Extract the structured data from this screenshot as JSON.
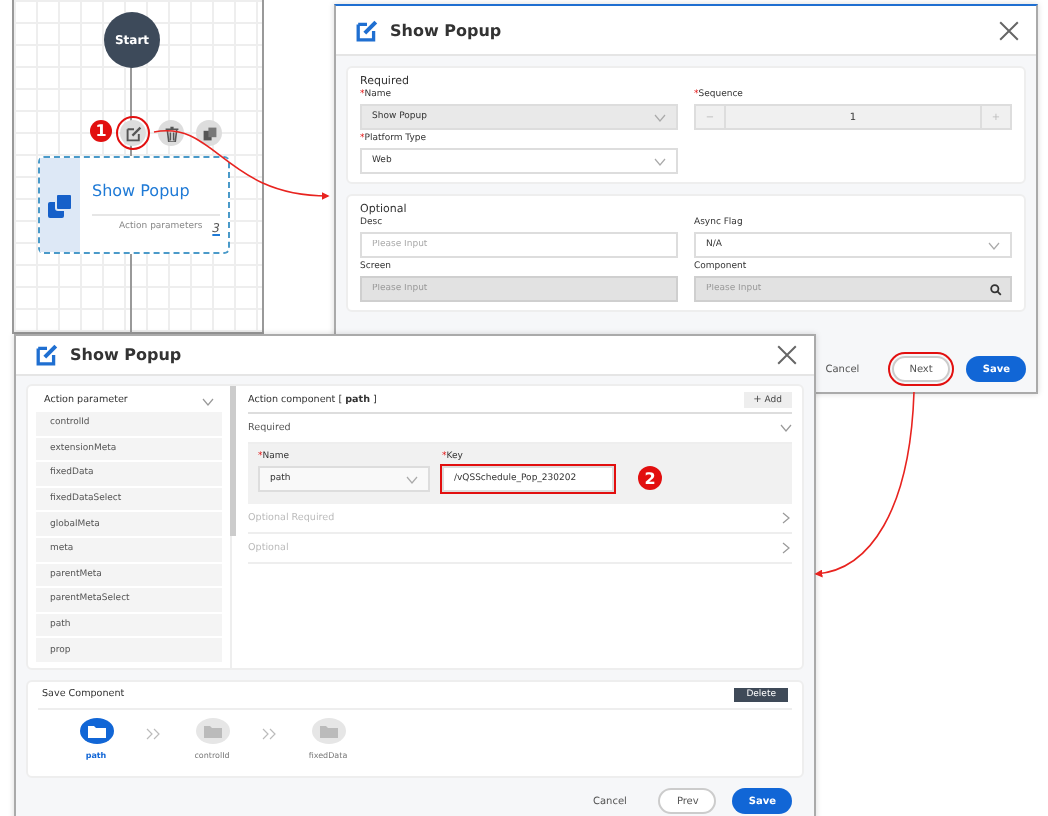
{
  "canvas": {
    "start_node": "Start",
    "badge": "1",
    "edit_highlighted": true,
    "node": {
      "title": "Show Popup",
      "label": "Action parameters",
      "count": "3"
    }
  },
  "dialog_1": {
    "title": "Show Popup",
    "required": {
      "heading": "Required",
      "fields": [
        {
          "label": "Name",
          "required_mark": "*",
          "kind": "select",
          "value": "Show Popup",
          "disabled": true
        },
        {
          "label": "Sequence",
          "required_mark": "*",
          "kind": "stepper",
          "value": "1",
          "minus": "−",
          "plus": "+",
          "disabled": true
        },
        {
          "label": "Platform Type",
          "required_mark": "*",
          "kind": "select",
          "value": "Web",
          "disabled": false
        }
      ]
    },
    "optional": {
      "heading": "Optional",
      "fields": [
        {
          "label": "Desc",
          "kind": "input",
          "placeholder": "Please Input",
          "disabled": false
        },
        {
          "label": "Async Flag",
          "kind": "select",
          "value": "N/A",
          "disabled": false
        },
        {
          "label": "Screen",
          "kind": "input",
          "placeholder": "Please Input",
          "disabled": true
        },
        {
          "label": "Component",
          "kind": "search",
          "placeholder": "Please Input",
          "disabled": true
        }
      ]
    },
    "buttons": [
      {
        "label": "Cancel",
        "kind": "text",
        "highlighted": false
      },
      {
        "label": "Next",
        "kind": "outline",
        "highlighted": true
      },
      {
        "label": "Save",
        "kind": "primary",
        "highlighted": false
      }
    ]
  },
  "dialog_2": {
    "title": "Show Popup",
    "sidebar": {
      "heading": "Action parameter",
      "items": [
        "controlId",
        "extensionMeta",
        "fixedData",
        "fixedDataSelect",
        "globalMeta",
        "meta",
        "parentMeta",
        "parentMetaSelect",
        "path",
        "prop"
      ]
    },
    "component": {
      "heading": "Action component [ **path** ]",
      "add_button": {
        "icon": "+",
        "label": "Add"
      },
      "sections": [
        {
          "title": "Required",
          "expanded": true,
          "fields": [
            {
              "label": "Name",
              "required_mark": "*",
              "kind": "select",
              "value": "path",
              "highlighted": false
            },
            {
              "label": "Key",
              "required_mark": "*",
              "kind": "input",
              "value": "/vQSSchedule_Pop_230202",
              "highlighted": true
            }
          ]
        },
        {
          "title": "Optional Required",
          "expanded": false
        },
        {
          "title": "Optional",
          "expanded": false
        }
      ]
    },
    "badge": "2",
    "save_component": {
      "heading": "Save Component",
      "delete_button": "Delete",
      "steps": [
        {
          "label": "path",
          "active": true
        },
        {
          "label": "controlId",
          "active": false
        },
        {
          "label": "fixedData",
          "active": false
        }
      ]
    },
    "buttons": [
      {
        "label": "Cancel",
        "kind": "text"
      },
      {
        "label": "Prev",
        "kind": "outline"
      },
      {
        "label": "Save",
        "kind": "primary"
      }
    ]
  }
}
